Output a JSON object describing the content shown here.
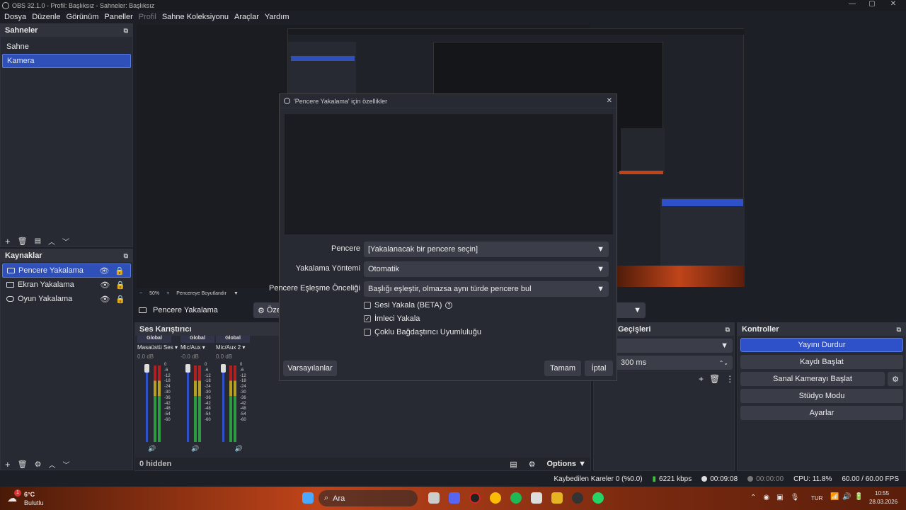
{
  "window": {
    "title": "OBS 32.1.0 - Profil: Başlıksız - Sahneler: Başlıksız",
    "min": "—",
    "max": "▢",
    "close": "✕"
  },
  "menu": [
    "Dosya",
    "Düzenle",
    "Görünüm",
    "Paneller",
    "Profil",
    "Sahne Koleksiyonu",
    "Araçlar",
    "Yardım"
  ],
  "scenes": {
    "title": "Sahneler",
    "items": [
      "Sahne",
      "Kamera"
    ],
    "selected": 1
  },
  "sources": {
    "title": "Kaynaklar",
    "items": [
      "Pencere Yakalama",
      "Ekran Yakalama",
      "Oyun Yakalama"
    ],
    "selected": 0
  },
  "zoom": {
    "minus": "−",
    "value": "50%",
    "plus": "+",
    "mode": "Pencereye Boyutlandır"
  },
  "source_bar": {
    "name": "Pencere Yakalama",
    "properties": "Özellikler"
  },
  "mixer": {
    "title": "Ses Karıştırıcı",
    "channels": [
      {
        "group": "Global",
        "name": "Masaüstü Ses",
        "db": "0.0 dB"
      },
      {
        "group": "Global",
        "name": "Mic/Aux",
        "db": "-0.0 dB"
      },
      {
        "group": "Global",
        "name": "Mic/Aux 2",
        "db": "0.0 dB"
      }
    ],
    "scale": [
      "0",
      "-6",
      "-12",
      "-18",
      "-24",
      "-30",
      "-36",
      "-42",
      "-48",
      "-54",
      "-60"
    ],
    "hidden": "0 hidden",
    "options": "Options"
  },
  "transitions": {
    "title": "Geçişleri",
    "duration": "300 ms"
  },
  "controls": {
    "title": "Kontroller",
    "buttons": [
      "Yayını Durdur",
      "Kaydı Başlat",
      "Sanal Kamerayı Başlat",
      "Stüdyo Modu",
      "Ayarlar"
    ]
  },
  "status": {
    "dropped": "Kaybedilen Kareler 0 (%0.0)",
    "bitrate": "6221 kbps",
    "stream_time": "00:09:08",
    "rec_time": "00:00:00",
    "cpu": "CPU: 11.8%",
    "fps": "60.00 / 60.00 FPS"
  },
  "dialog": {
    "title": "'Pencere Yakalama' için özellikler",
    "fields": [
      {
        "label": "Pencere",
        "value": "[Yakalanacak bir pencere seçin]"
      },
      {
        "label": "Yakalama Yöntemi",
        "value": "Otomatik"
      },
      {
        "label": "Pencere Eşleşme Önceliği",
        "value": "Başlığı eşleştir, olmazsa aynı türde pencere bul"
      }
    ],
    "checks": [
      {
        "label": "Sesi Yakala (BETA)",
        "checked": false
      },
      {
        "label": "İmleci Yakala",
        "checked": true
      },
      {
        "label": "Çoklu Bağdaştırıcı Uyumluluğu",
        "checked": false
      }
    ],
    "defaults": "Varsayılanlar",
    "ok": "Tamam",
    "cancel": "İptal"
  },
  "taskbar": {
    "temp": "6°C",
    "weather": "Bulutlu",
    "search": "Ara",
    "lang": "TUR",
    "time": "10:55",
    "date": "28.03.2026",
    "badge": "1"
  }
}
